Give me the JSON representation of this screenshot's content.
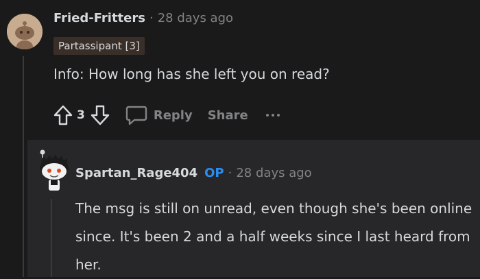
{
  "comment1": {
    "username": "Fried-Fritters",
    "separator": "·",
    "timestamp": "28 days ago",
    "flair": "Partassipant [3]",
    "body": "Info: How long has she left you on read?",
    "score": "3",
    "reply_label": "Reply",
    "share_label": "Share"
  },
  "comment2": {
    "username": "Spartan_Rage404",
    "op_badge": "OP",
    "separator": "·",
    "timestamp": "28 days ago",
    "body": "The msg is still on unread, even though she's been online since. It's been 2 and a half weeks since I last heard from her."
  },
  "colors": {
    "background": "#1a1a1b",
    "highlight_panel": "#272729",
    "op_blue": "#2b8cf2",
    "flair_bg": "#3a2e28"
  },
  "icons": [
    "snoo-avatar-icon",
    "upvote-arrow-icon",
    "downvote-arrow-icon",
    "comment-bubble-icon",
    "more-options-icon"
  ]
}
